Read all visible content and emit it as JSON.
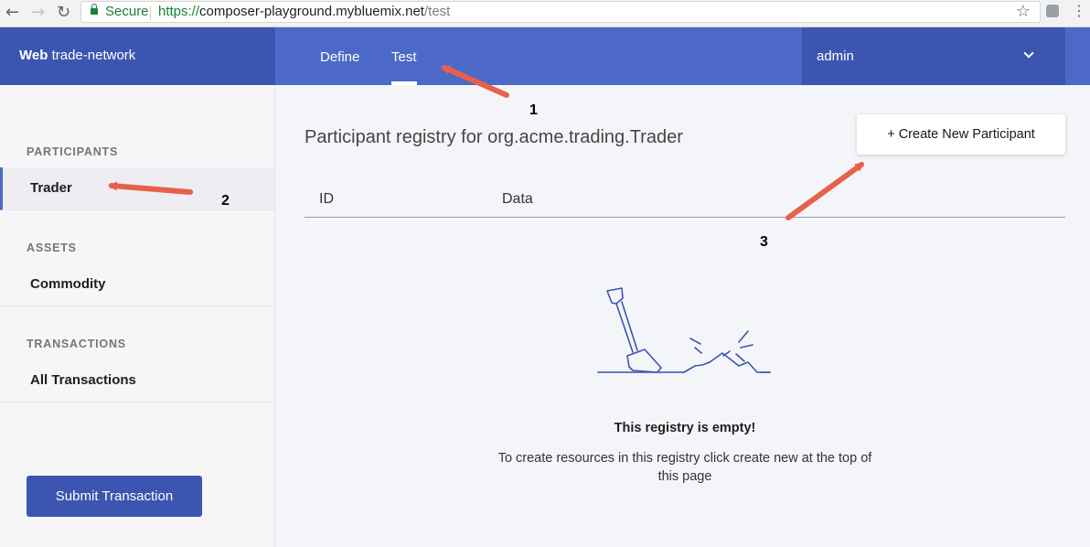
{
  "browser": {
    "secure_label": "Secure",
    "url_scheme": "https://",
    "url_host": "composer-playground.mybluemix.net",
    "url_path": "/test"
  },
  "header": {
    "brand_bold": "Web",
    "brand_rest": " trade-network",
    "tabs": [
      {
        "label": "Define",
        "active": false
      },
      {
        "label": "Test",
        "active": true
      }
    ],
    "user": "admin"
  },
  "sidebar": {
    "sections": [
      {
        "heading": "PARTICIPANTS",
        "items": [
          {
            "label": "Trader",
            "active": true
          }
        ]
      },
      {
        "heading": "ASSETS",
        "items": [
          {
            "label": "Commodity",
            "active": false
          }
        ]
      },
      {
        "heading": "TRANSACTIONS",
        "items": [
          {
            "label": "All Transactions",
            "active": false
          }
        ]
      }
    ],
    "submit_label": "Submit Transaction"
  },
  "main": {
    "title": "Participant registry for org.acme.trading.Trader",
    "create_label": "+ Create New Participant",
    "columns": [
      "ID",
      "Data"
    ],
    "empty_title": "This registry is empty!",
    "empty_message": "To create resources in this registry click create new at the top of this page"
  },
  "annotations": [
    "1",
    "2",
    "3"
  ],
  "colors": {
    "header": "#4d69c7",
    "header_dark": "#3b55b0",
    "arrow": "#e8604c"
  }
}
